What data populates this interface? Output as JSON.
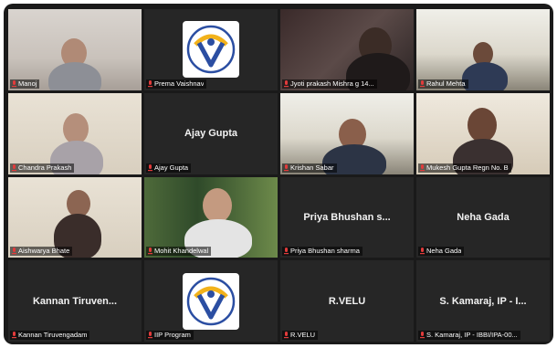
{
  "participants": [
    {
      "name": "Manoj",
      "display": "video"
    },
    {
      "name": "Prema Vaishnav",
      "display": "logo"
    },
    {
      "name": "Jyoti prakash Mishra g 14...",
      "display": "video"
    },
    {
      "name": "Rahul Mehta",
      "display": "video"
    },
    {
      "name": "Chandra Prakash",
      "display": "video"
    },
    {
      "name": "Ajay Gupta",
      "display": "name",
      "center_label": "Ajay Gupta"
    },
    {
      "name": "Krishan Sabar",
      "display": "video",
      "speaking": true
    },
    {
      "name": "Mukesh Gupta Regn No. B",
      "display": "video"
    },
    {
      "name": "Aishwarya Bhate",
      "display": "video"
    },
    {
      "name": "Mohit Khandelwal",
      "display": "video"
    },
    {
      "name": "Priya Bhushan sharma",
      "display": "name",
      "center_label": "Priya Bhushan s..."
    },
    {
      "name": "Neha Gada",
      "display": "name",
      "center_label": "Neha Gada"
    },
    {
      "name": "Kannan Tiruvengadam",
      "display": "name",
      "center_label": "Kannan Tiruven..."
    },
    {
      "name": "IIP Program",
      "display": "logo"
    },
    {
      "name": "R.VELU",
      "display": "name",
      "center_label": "R.VELU"
    },
    {
      "name": "S. Kamaraj, IP - IBBI/IPA-00...",
      "display": "name",
      "center_label": "S. Kamaraj, IP - I..."
    }
  ],
  "colors": {
    "tile_bg": "#262626",
    "frame_bg": "#1a1a1a",
    "mute_red": "#e23b3b",
    "speaker_outline": "#c9e53a",
    "logo_blue": "#2b4ea2",
    "logo_yellow": "#f2b21b"
  },
  "icons": {
    "muted": "mic-muted-icon",
    "logo": "institute-logo-icon"
  }
}
